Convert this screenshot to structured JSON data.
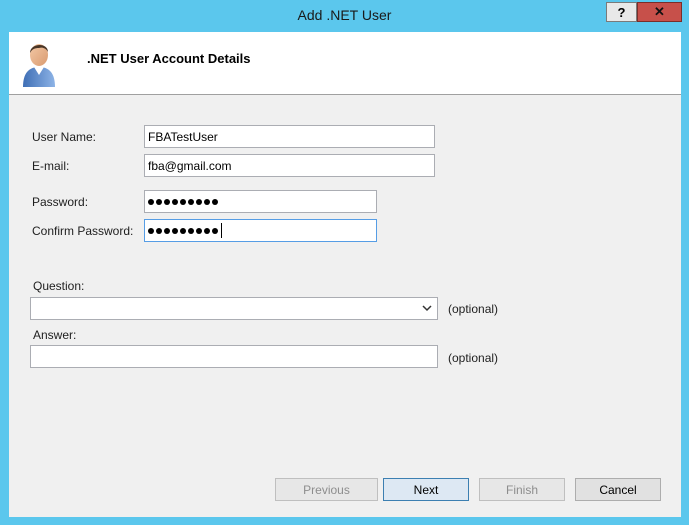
{
  "window": {
    "title": "Add .NET User",
    "help_label": "?",
    "close_label": "✕"
  },
  "header": {
    "title": ".NET User Account Details",
    "icon": "user-avatar-icon"
  },
  "form": {
    "user_name": {
      "label": "User Name:",
      "value": "FBATestUser"
    },
    "email": {
      "label": "E-mail:",
      "value": "fba@gmail.com"
    },
    "password": {
      "label": "Password:",
      "masked_length": 9
    },
    "confirm_password": {
      "label": "Confirm Password:",
      "masked_length": 9
    },
    "question": {
      "label": "Question:",
      "selected": "",
      "optional": "(optional)"
    },
    "answer": {
      "label": "Answer:",
      "value": "",
      "optional": "(optional)"
    }
  },
  "buttons": {
    "previous": "Previous",
    "next": "Next",
    "finish": "Finish",
    "cancel": "Cancel"
  },
  "colors": {
    "title_bar": "#5bc7ed",
    "close_button": "#c7504a",
    "focus_border": "#569de5",
    "default_button_border": "#3c7fb1"
  }
}
